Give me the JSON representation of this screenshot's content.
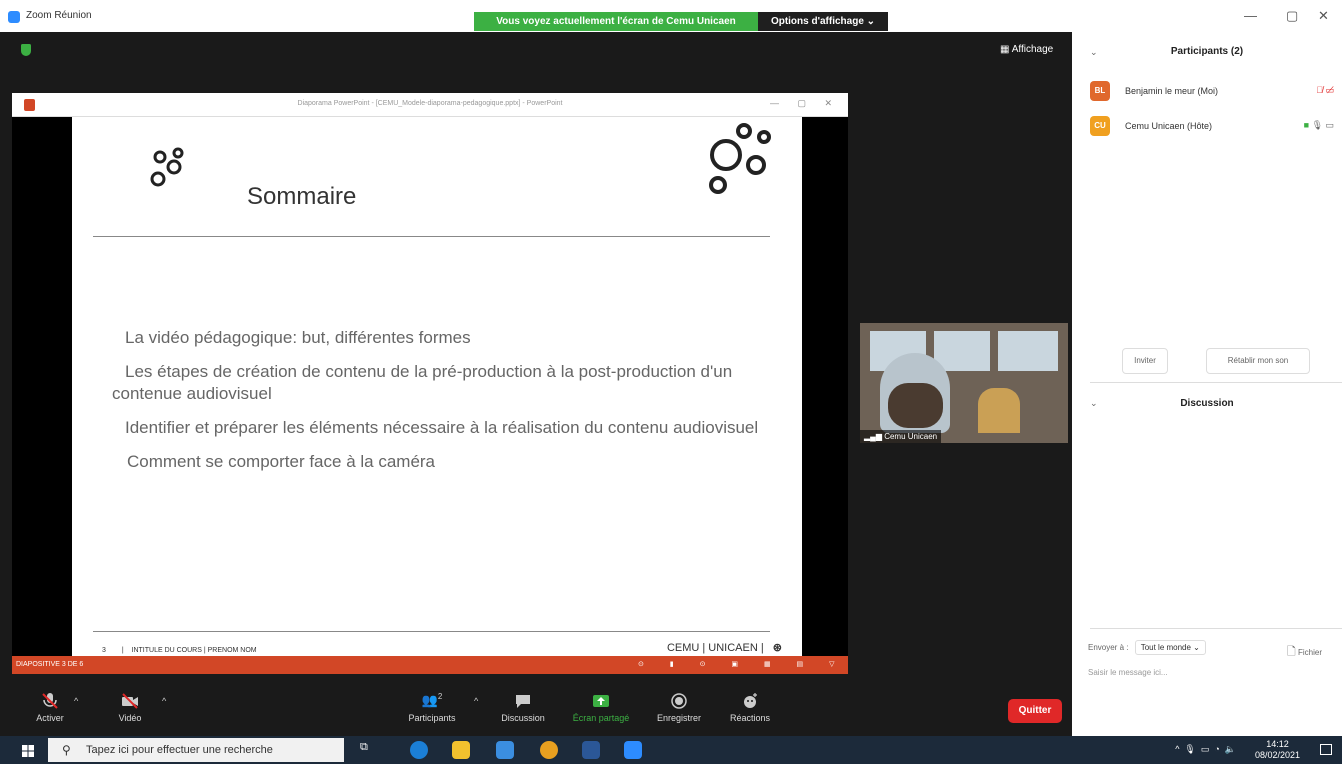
{
  "window": {
    "title": "Zoom Réunion",
    "share_banner": "Vous voyez actuellement l'écran de Cemu Unicaen",
    "view_options": "Options d'affichage ⌄",
    "affichage": "Affichage",
    "minimize": "—",
    "restore": "▢",
    "close": "✕"
  },
  "ppt": {
    "window_title": "Diaporama PowerPoint - [CEMU_Modele-diaporama-pedagogique.pptx] - PowerPoint",
    "window_controls": "— ▢ ✕",
    "slide_title": "Sommaire",
    "bullets": [
      "La vidéo pédagogique: but, différentes formes",
      "Les étapes de création de contenu de la pré-production à la post-production d'un contenue audiovisuel",
      "Identifier et préparer les éléments nécessaire à la réalisation du contenu audiovisuel",
      "Comment se comporter face à la caméra"
    ],
    "footer_page": "3",
    "footer_text": "INTITULE DU COURS | PRENOM NOM",
    "footer_logos": "CEMU  |  UNICAEN  |",
    "status_left": "DIAPOSITIVE 3 DE 6"
  },
  "video": {
    "name": "Cemu Unicaen"
  },
  "toolbar": {
    "activer": "Activer",
    "video": "Vidéo",
    "participants": "Participants",
    "participants_count": "2",
    "discussion": "Discussion",
    "share": "Écran partagé",
    "record": "Enregistrer",
    "reactions": "Réactions",
    "quit": "Quitter"
  },
  "sidebar": {
    "participants_header": "Participants (2)",
    "participants": [
      {
        "initials": "BL",
        "name": "Benjamin le meur (Moi)",
        "color": "#e0682c"
      },
      {
        "initials": "CU",
        "name": "Cemu Unicaen (Hôte)",
        "color": "#f0a020"
      }
    ],
    "invite": "Inviter",
    "unmute": "Rétablir mon son",
    "discussion_header": "Discussion",
    "send_to_label": "Envoyer à :",
    "send_to_value": "Tout le monde ⌄",
    "file": "Fichier",
    "message_placeholder": "Saisir le message ici..."
  },
  "taskbar": {
    "search": "Tapez ici pour effectuer une recherche",
    "time": "14:12",
    "date": "08/02/2021"
  },
  "colors": {
    "zoom_blue": "#2d8cff",
    "share_green": "#3cb043",
    "ppt_orange": "#d24726",
    "quit_red": "#e02828"
  }
}
